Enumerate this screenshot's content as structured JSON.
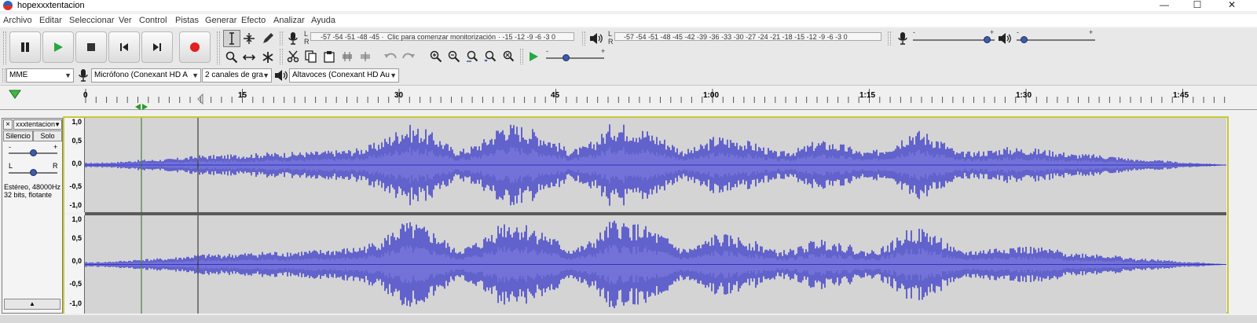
{
  "window": {
    "title": "hopexxxtentacion",
    "controls": [
      "—",
      "☐",
      "✕"
    ]
  },
  "menu": [
    "Archivo",
    "Editar",
    "Seleccionar",
    "Ver",
    "Control",
    "Pistas",
    "Generar",
    "Efecto",
    "Analizar",
    "Ayuda"
  ],
  "meters": {
    "recording": {
      "L": "L",
      "R": "R",
      "scale_left": "-57 -54 -51 -48 -45 ·",
      "prompt": "Clic para comenzar monitorización",
      "scale_right": "· -15 -12 -9 -6 -3 0"
    },
    "playback": {
      "L": "L",
      "R": "R",
      "scale": "-57 -54 -51 -48 -45 -42 -39 -36 -33 -30 -27 -24 -21 -18 -15 -12 -9 -6 -3 0"
    }
  },
  "mixer": {
    "minus": "-",
    "plus": "+",
    "record_volume": 0.95,
    "playback_volume": 0.05
  },
  "play_speed": {
    "minus": "-",
    "plus": "+",
    "value": 0.33
  },
  "devices": {
    "host": "MME",
    "mic": "Micrófono (Conexant HD A",
    "channels": "2 canales de gra",
    "speaker": "Altavoces (Conexant HD Au"
  },
  "timeline": {
    "labels": [
      "0",
      "15",
      "30",
      "45",
      "1:00",
      "1:15",
      "1:30",
      "1:45"
    ]
  },
  "track": {
    "name": "xxxtentacion",
    "close": "×",
    "mute": "Silencio",
    "solo": "Solo",
    "gain_minus": "-",
    "gain_plus": "+",
    "pan_left": "L",
    "pan_right": "R",
    "gain": 0.5,
    "pan": 0.5,
    "info_line1": "Estéreo, 48000Hz",
    "info_line2": "32 bits, flotante",
    "collapse": "▲",
    "scale": [
      "1,0",
      "0,5",
      "0,0",
      "-0,5",
      "-1,0"
    ]
  },
  "colors": {
    "waveform": "#3232c8",
    "waveform_rms": "#6464dc",
    "clip_bg": "#d4d4d4",
    "record": "#e0211e",
    "play": "#27a844"
  }
}
